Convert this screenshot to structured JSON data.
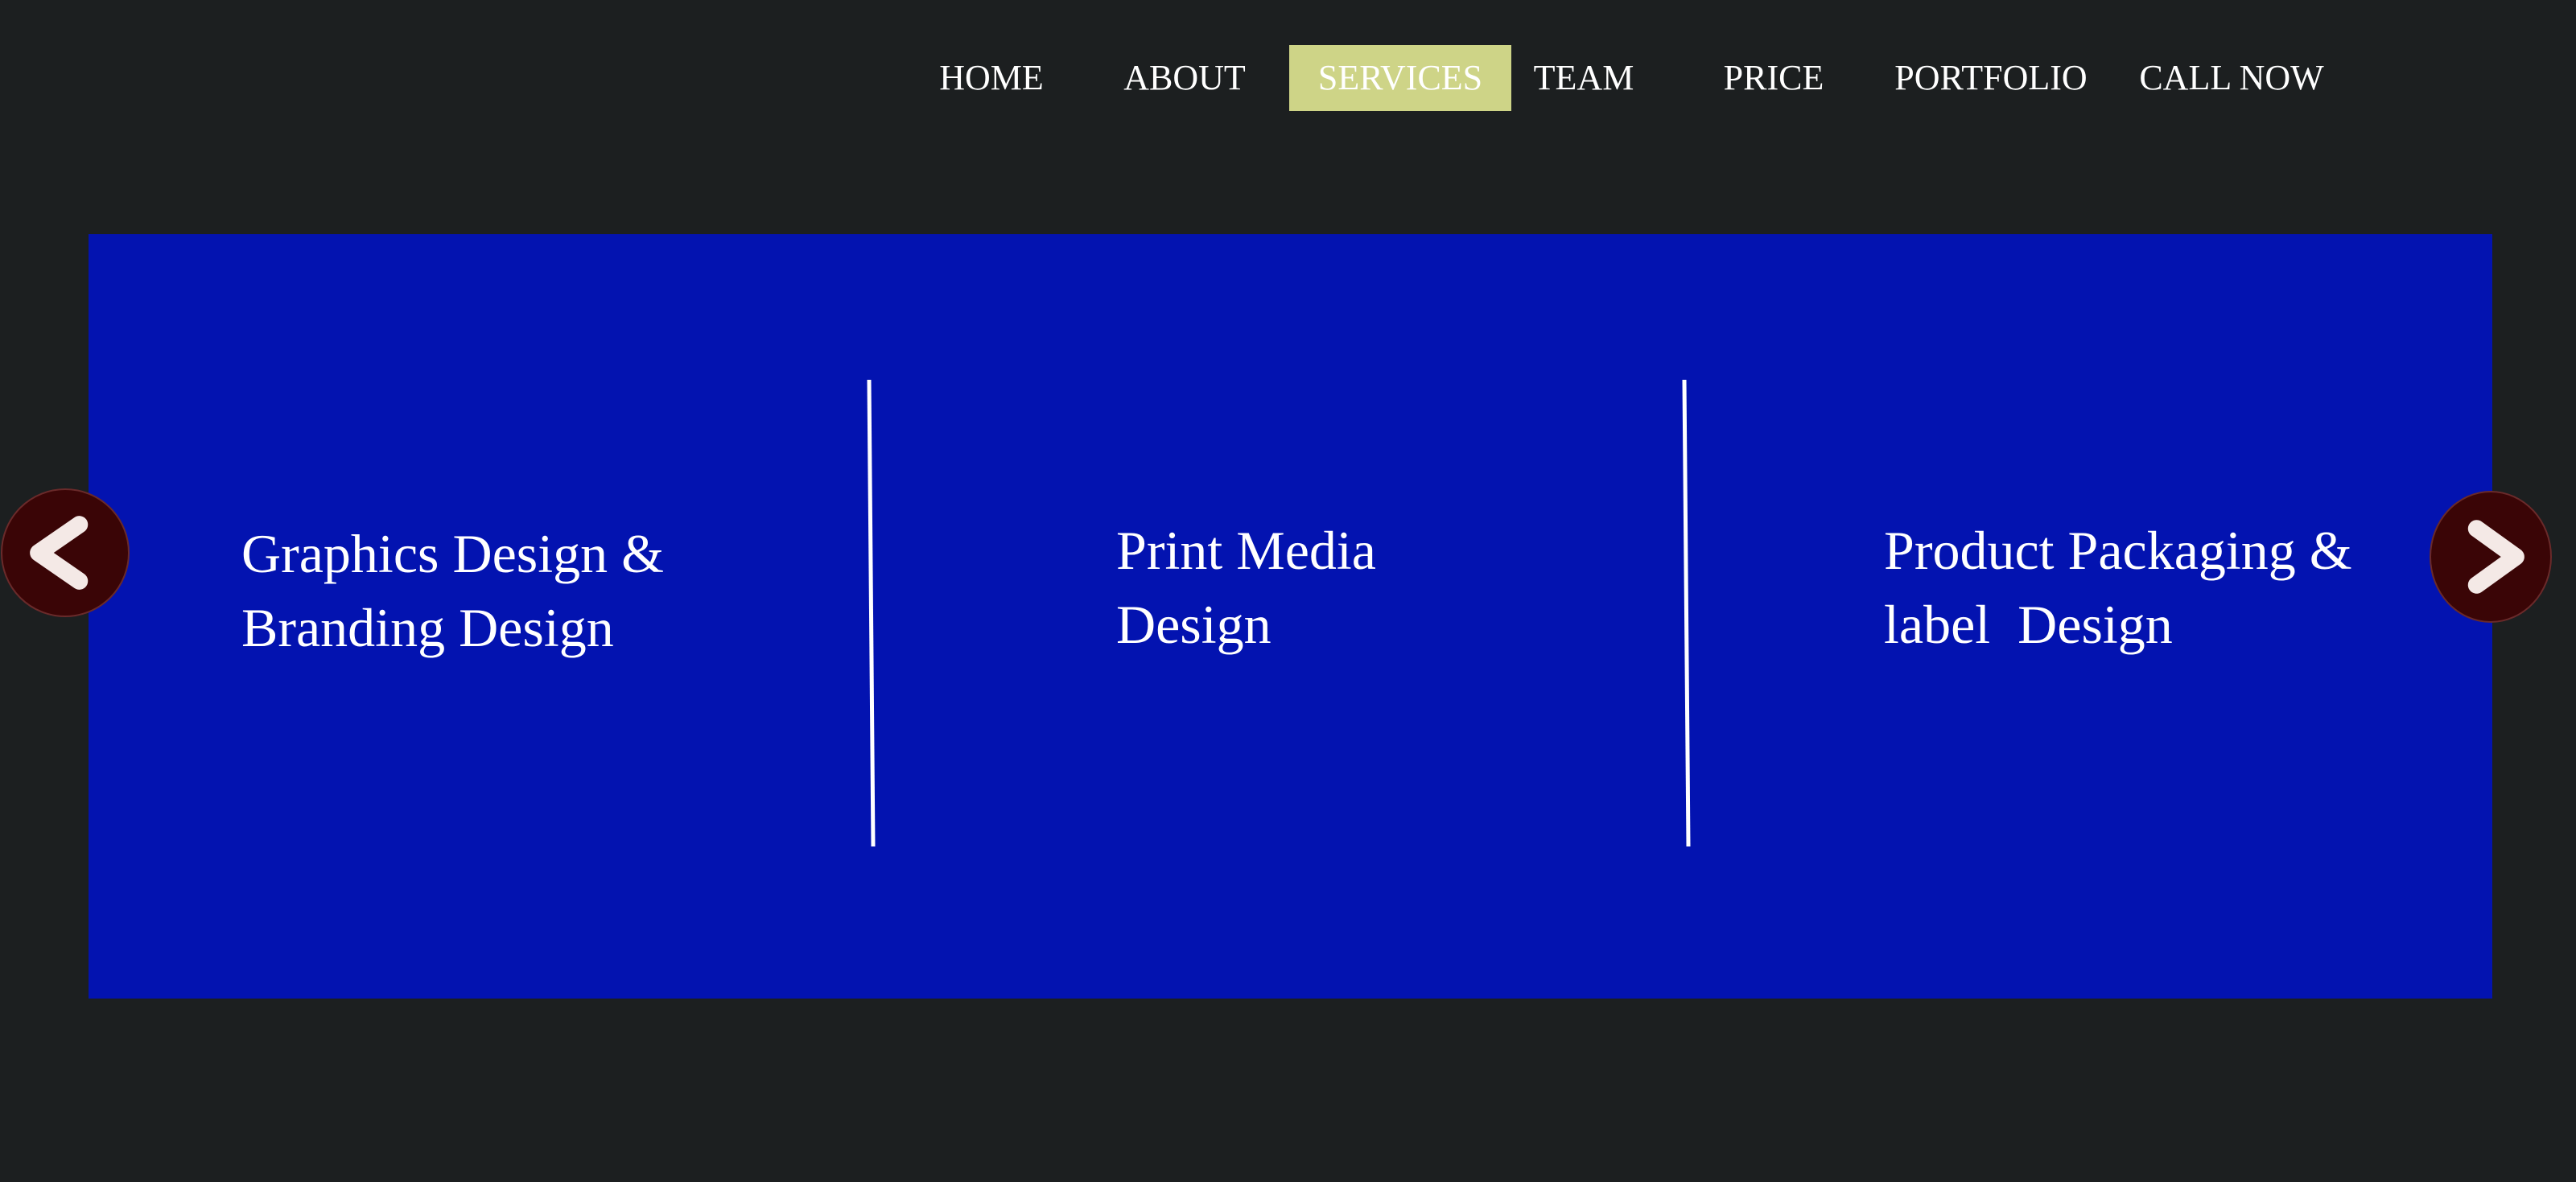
{
  "nav": {
    "items": [
      {
        "label": "HOME"
      },
      {
        "label": "ABOUT"
      },
      {
        "label": "SERVICES",
        "active": true
      },
      {
        "label": "TEAM"
      },
      {
        "label": "PRICE"
      },
      {
        "label": "PORTFOLIO"
      },
      {
        "label": "CALL NOW"
      }
    ]
  },
  "slider": {
    "services": [
      {
        "line1": "Graphics Design &",
        "line2": "Branding Design"
      },
      {
        "line1": "Print Media",
        "line2": "Design"
      },
      {
        "line1": "Product Packaging &",
        "line2": "label  Design"
      }
    ],
    "prev_icon": "chevron-left-icon",
    "next_icon": "chevron-right-icon"
  },
  "colors": {
    "background": "#1c1f20",
    "panel": "#0313b0",
    "nav_active": "#ced487",
    "arrow_button": "#3a0506",
    "text": "#ffffff"
  }
}
